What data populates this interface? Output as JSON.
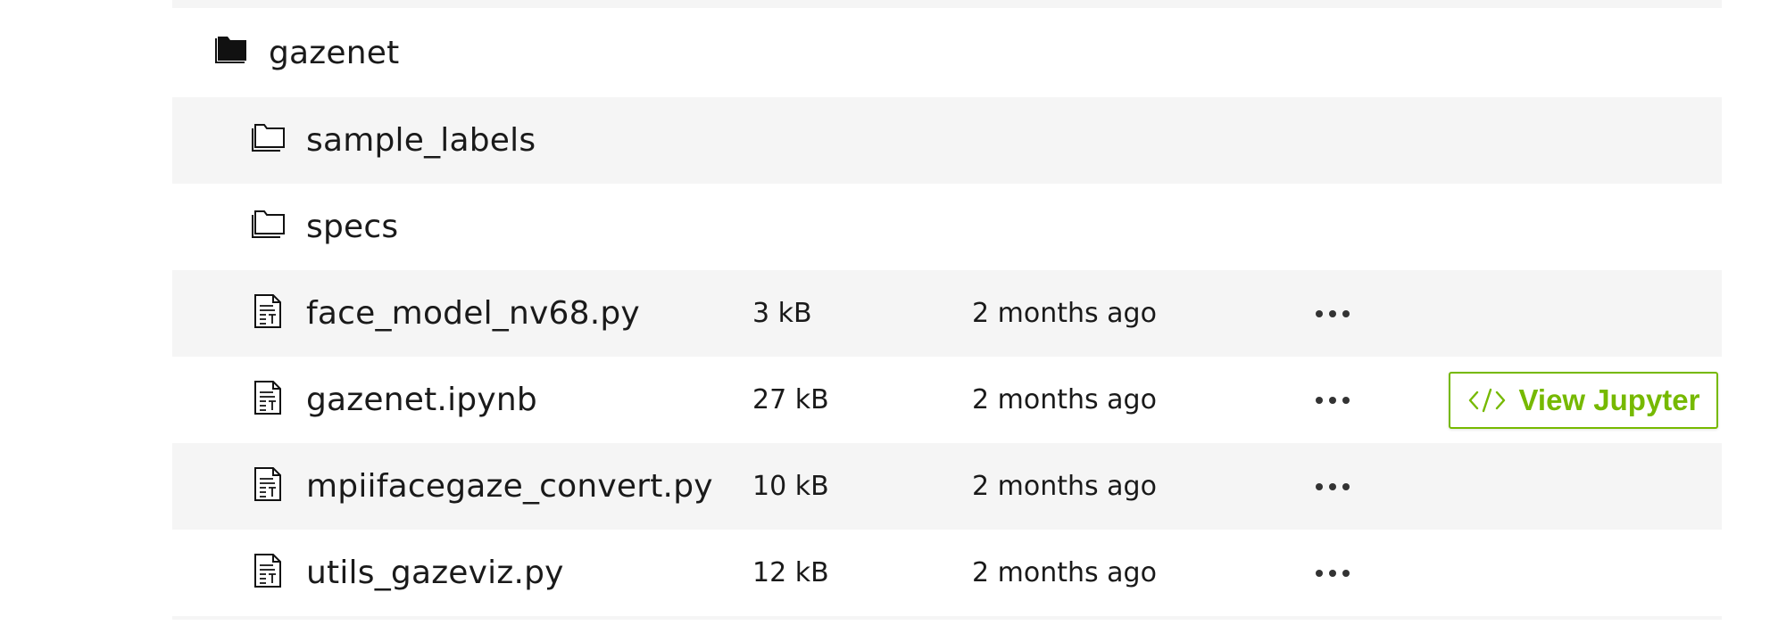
{
  "tree": {
    "root_folder": {
      "name": "gazenet",
      "icon": "folder-filled-icon"
    },
    "subfolders": [
      {
        "name": "sample_labels",
        "icon": "folder-outline-icon"
      },
      {
        "name": "specs",
        "icon": "folder-outline-icon"
      }
    ],
    "files": [
      {
        "name": "face_model_nv68.py",
        "size": "3 kB",
        "modified": "2 months ago",
        "icon": "file-text-icon"
      },
      {
        "name": "gazenet.ipynb",
        "size": "27 kB",
        "modified": "2 months ago",
        "icon": "file-text-icon"
      },
      {
        "name": "mpiifacegaze_convert.py",
        "size": "10 kB",
        "modified": "2 months ago",
        "icon": "file-text-icon"
      },
      {
        "name": "utils_gazeviz.py",
        "size": "12 kB",
        "modified": "2 months ago",
        "icon": "file-text-icon"
      }
    ],
    "more_icon": "more-horizontal-icon"
  },
  "view_button": {
    "label": "View Jupyter",
    "icon": "code-icon",
    "accent_color": "#76b900"
  },
  "colors": {
    "row_alt_background": "#f5f5f5",
    "text": "#1a1a1a"
  }
}
